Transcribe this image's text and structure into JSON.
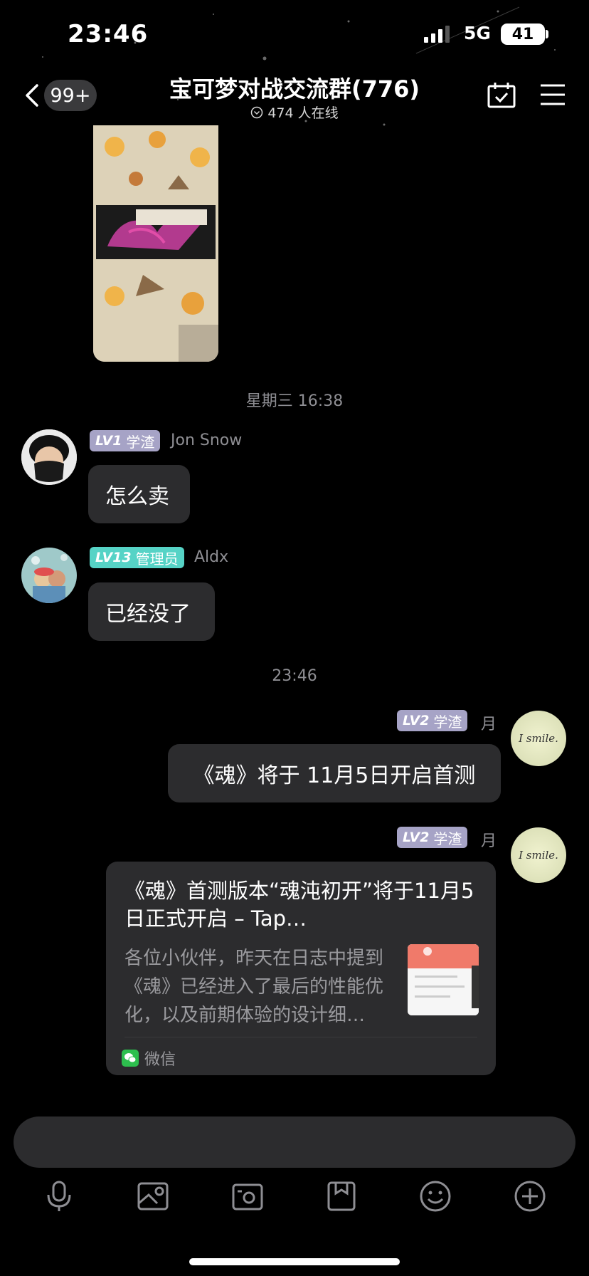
{
  "status_bar": {
    "time": "23:46",
    "network": "5G",
    "battery": "41"
  },
  "header": {
    "unread": "99+",
    "title": "宝可梦对战交流群(776)",
    "online": "474 人在线"
  },
  "messages": [
    {
      "type": "timestamp",
      "text": "星期三 16:38"
    },
    {
      "sender": "Jon Snow",
      "level": "LV1",
      "title": "学渣",
      "badge_color": "#a6a3c6",
      "text": "怎么卖"
    },
    {
      "sender": "Aldx",
      "level": "LV13",
      "title": "管理员",
      "badge_color": "#56d3c6",
      "text": "已经没了"
    },
    {
      "type": "timestamp",
      "text": "23:46"
    },
    {
      "sender": "月",
      "level": "LV2",
      "title": "学渣",
      "badge_color": "#a6a3c6",
      "text": "《魂》将于 11月5日开启首测",
      "avatar_text": "I smile."
    },
    {
      "sender": "月",
      "level": "LV2",
      "title": "学渣",
      "badge_color": "#a6a3c6",
      "avatar_text": "I smile.",
      "card": {
        "title": "《魂》首测版本“魂沌初开”将于11月5日正式开启 – Tap…",
        "description": "各位小伙伴，昨天在日志中提到《魂》已经进入了最后的性能优化，以及前期体验的设计细…",
        "source": "微信"
      }
    }
  ],
  "input": {
    "placeholder": ""
  },
  "toolbar": [
    "microphone-icon",
    "image-icon",
    "camera-icon",
    "file-icon",
    "emoji-icon",
    "plus-icon"
  ]
}
